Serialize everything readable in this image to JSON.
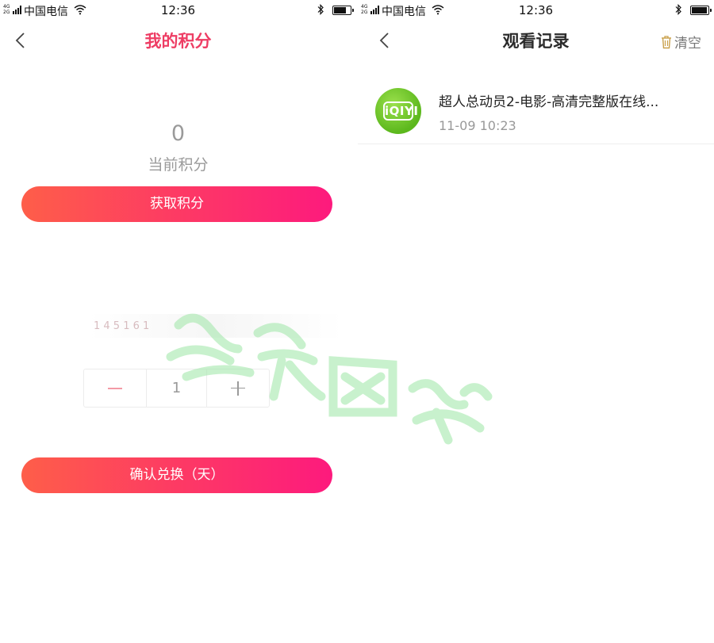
{
  "left_screen": {
    "status_bar": {
      "signal_small_top": "4G",
      "signal_small_bottom": "2G",
      "carrier": "中国电信",
      "time": "12:36",
      "battery_percent": 70
    },
    "nav": {
      "title": "我的积分"
    },
    "points": {
      "value": "0",
      "label": "当前积分"
    },
    "get_points_button": "获取积分",
    "faded_row_text": "1 4 5 1 6 1",
    "stepper": {
      "quantity": "1"
    },
    "confirm_button": "确认兑换（天）",
    "colors": {
      "title": "#ee3d64",
      "gradient_start": "#fe5e49",
      "gradient_end": "#fd1a7d"
    }
  },
  "right_screen": {
    "status_bar": {
      "signal_small_top": "4G",
      "signal_small_bottom": "2G",
      "carrier": "中国电信",
      "time": "12:36",
      "battery_percent": 85
    },
    "nav": {
      "title": "观看记录",
      "clear_label": "清空"
    },
    "records": [
      {
        "logo_text": "iQIYI",
        "title": "超人总动员2-电影-高清完整版在线...",
        "time": "11-09 10:23"
      }
    ],
    "colors": {
      "logo": "#5cb81d"
    }
  },
  "watermark_icons": [
    "trash-icon",
    "back-icon",
    "wifi-icon",
    "bluetooth-icon",
    "battery-icon"
  ]
}
